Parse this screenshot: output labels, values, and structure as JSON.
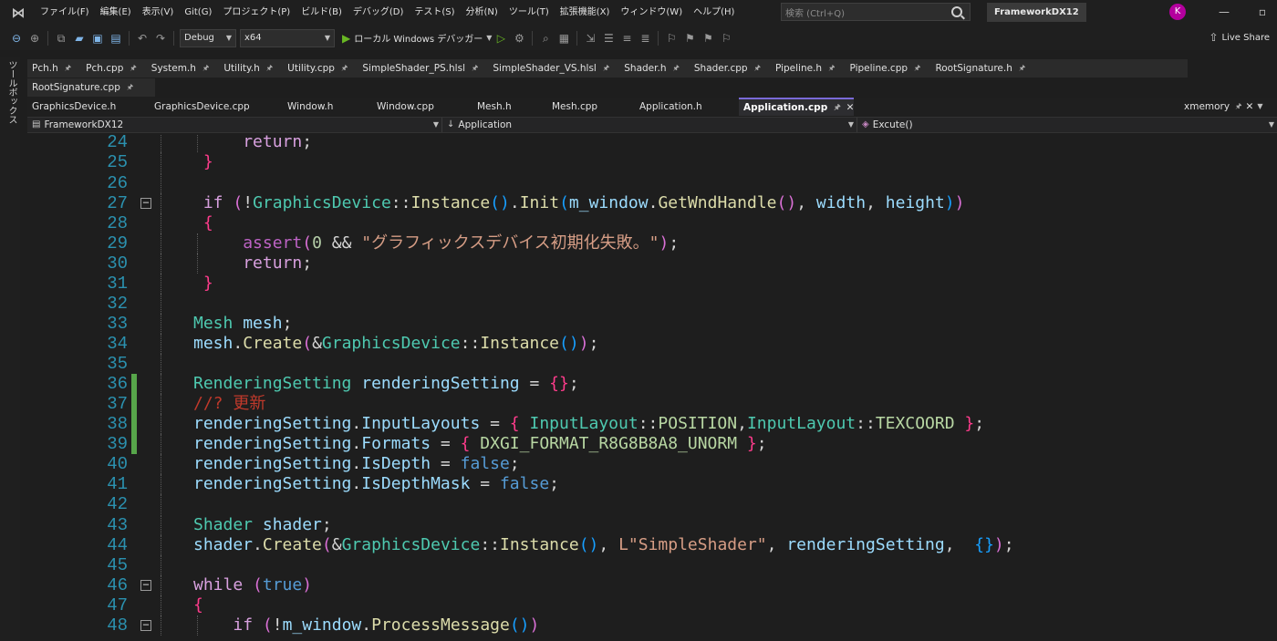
{
  "menubar": {
    "items": [
      "ファイル(F)",
      "編集(E)",
      "表示(V)",
      "Git(G)",
      "プロジェクト(P)",
      "ビルド(B)",
      "デバッグ(D)",
      "テスト(S)",
      "分析(N)",
      "ツール(T)",
      "拡張機能(X)",
      "ウィンドウ(W)",
      "ヘルプ(H)"
    ],
    "search_placeholder": "検索 (Ctrl+Q)",
    "solution_name": "FrameworkDX12",
    "avatar_initial": "K"
  },
  "toolbar": {
    "configuration": "Debug",
    "platform": "x64",
    "run_label": "ローカル Windows デバッガー",
    "live_share": "Live Share"
  },
  "toolbox": {
    "label": "ツールボックス"
  },
  "tabs": {
    "row1": [
      "Pch.h",
      "Pch.cpp",
      "System.h",
      "Utility.h",
      "Utility.cpp",
      "SimpleShader_PS.hlsl",
      "SimpleShader_VS.hlsl",
      "Shader.h",
      "Shader.cpp",
      "Pipeline.h",
      "Pipeline.cpp",
      "RootSignature.h"
    ],
    "row2": [
      "RootSignature.cpp"
    ],
    "row3": [
      "GraphicsDevice.h",
      "GraphicsDevice.cpp",
      "Window.h",
      "Window.cpp",
      "Mesh.h",
      "Mesh.cpp",
      "Application.h"
    ],
    "active": "Application.cpp",
    "side": "xmemory"
  },
  "navbar": {
    "project": "FrameworkDX12",
    "scope": "Application",
    "member": "Excute()"
  },
  "editor": {
    "line_numbers": [
      "24",
      "25",
      "26",
      "27",
      "28",
      "29",
      "30",
      "31",
      "32",
      "33",
      "34",
      "35",
      "36",
      "37",
      "38",
      "39",
      "40",
      "41",
      "42",
      "43",
      "44",
      "45",
      "46",
      "47",
      "48"
    ],
    "string_literal": "\"グラフィックスデバイス初期化失敗。\"",
    "comment": "//? 更新",
    "shader_name": "L\"SimpleShader\""
  }
}
